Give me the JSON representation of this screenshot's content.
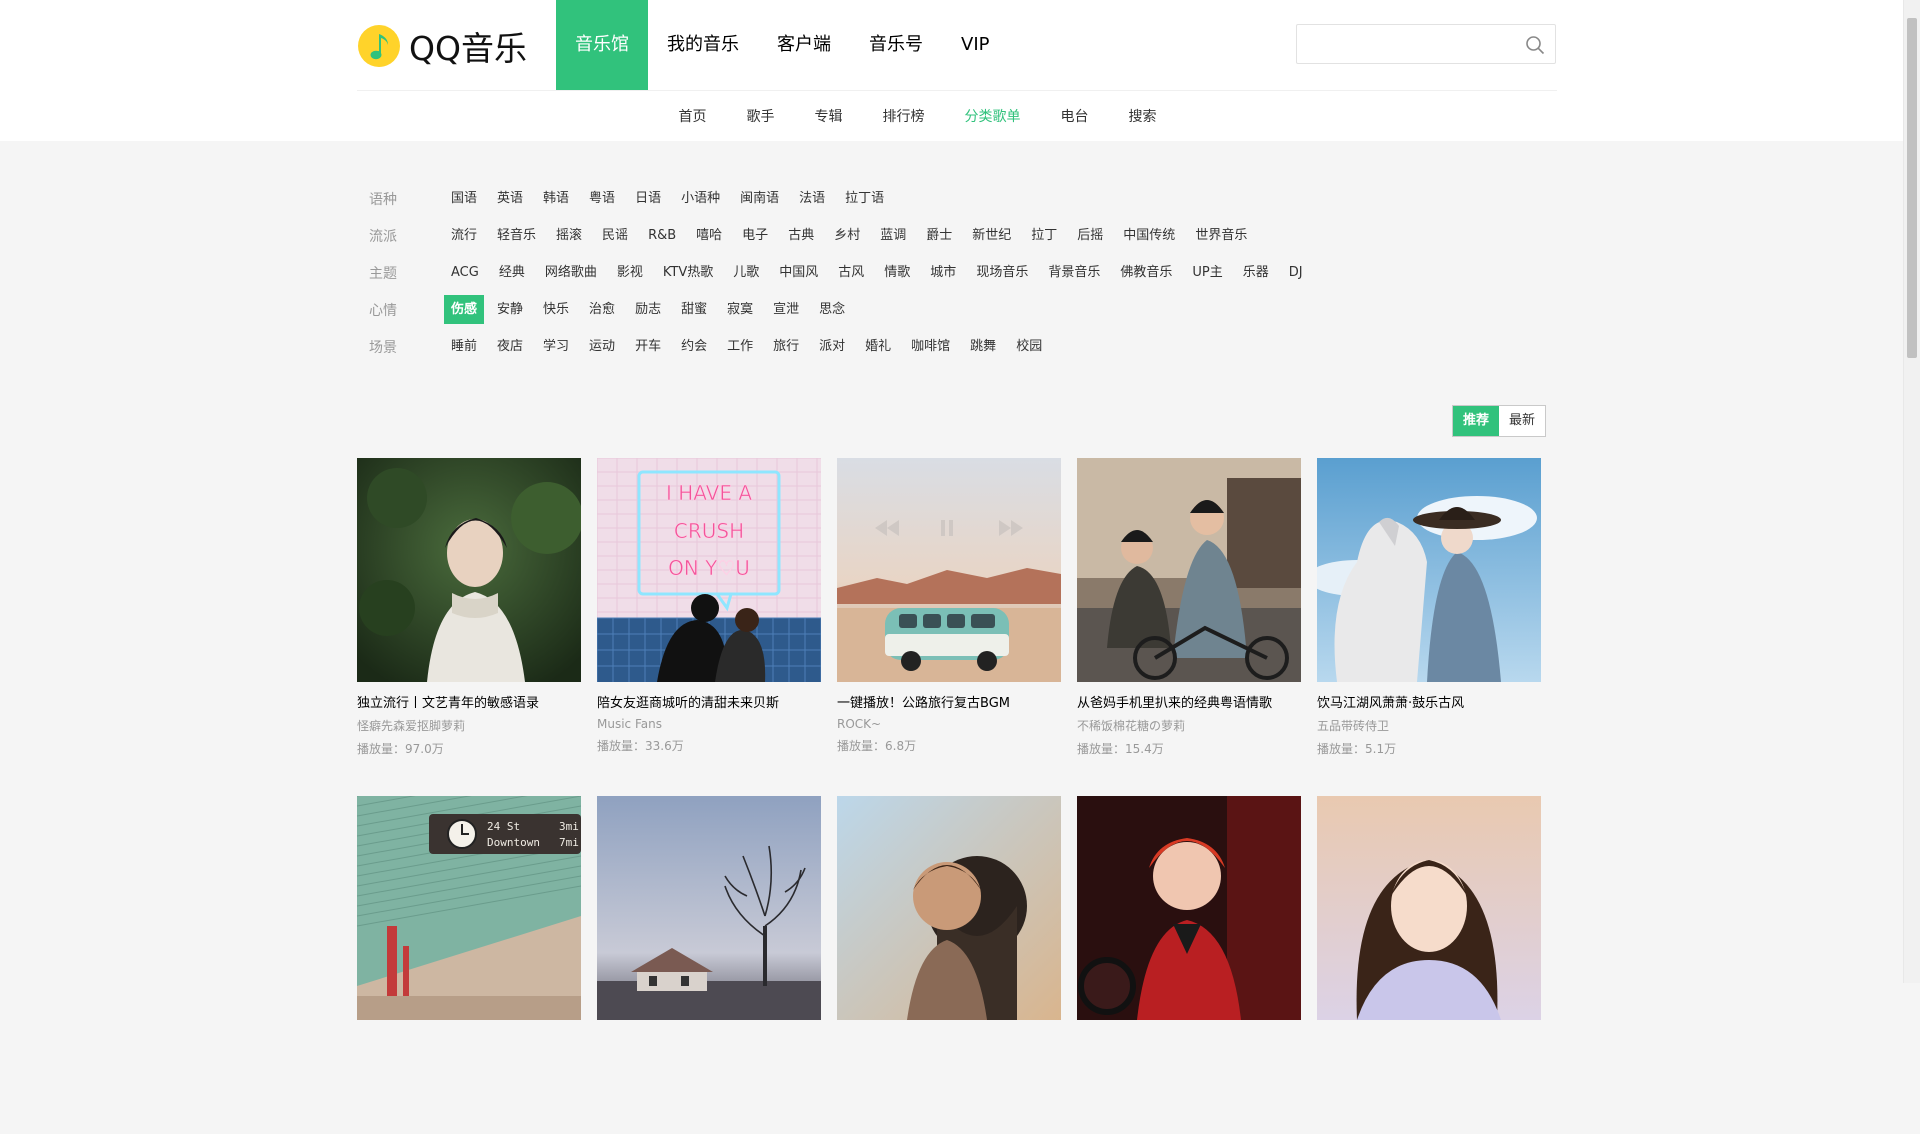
{
  "brand": {
    "name": "QQ音乐",
    "color": "#31c27c"
  },
  "main_nav": [
    {
      "label": "音乐馆",
      "active": true
    },
    {
      "label": "我的音乐",
      "active": false
    },
    {
      "label": "客户端",
      "active": false
    },
    {
      "label": "音乐号",
      "active": false
    },
    {
      "label": "VIP",
      "active": false
    }
  ],
  "search": {
    "placeholder": "",
    "value": ""
  },
  "sub_nav": [
    {
      "label": "首页",
      "active": false
    },
    {
      "label": "歌手",
      "active": false
    },
    {
      "label": "专辑",
      "active": false
    },
    {
      "label": "排行榜",
      "active": false
    },
    {
      "label": "分类歌单",
      "active": true
    },
    {
      "label": "电台",
      "active": false
    },
    {
      "label": "搜索",
      "active": false
    }
  ],
  "filters": [
    {
      "label": "语种",
      "tags": [
        "国语",
        "英语",
        "韩语",
        "粤语",
        "日语",
        "小语种",
        "闽南语",
        "法语",
        "拉丁语"
      ],
      "active": null
    },
    {
      "label": "流派",
      "tags": [
        "流行",
        "轻音乐",
        "摇滚",
        "民谣",
        "R&B",
        "嘻哈",
        "电子",
        "古典",
        "乡村",
        "蓝调",
        "爵士",
        "新世纪",
        "拉丁",
        "后摇",
        "中国传统",
        "世界音乐"
      ],
      "active": null
    },
    {
      "label": "主题",
      "tags": [
        "ACG",
        "经典",
        "网络歌曲",
        "影视",
        "KTV热歌",
        "儿歌",
        "中国风",
        "古风",
        "情歌",
        "城市",
        "现场音乐",
        "背景音乐",
        "佛教音乐",
        "UP主",
        "乐器",
        "DJ"
      ],
      "active": null
    },
    {
      "label": "心情",
      "tags": [
        "伤感",
        "安静",
        "快乐",
        "治愈",
        "励志",
        "甜蜜",
        "寂寞",
        "宣泄",
        "思念"
      ],
      "active": "伤感"
    },
    {
      "label": "场景",
      "tags": [
        "睡前",
        "夜店",
        "学习",
        "运动",
        "开车",
        "约会",
        "工作",
        "旅行",
        "派对",
        "婚礼",
        "咖啡馆",
        "跳舞",
        "校园"
      ],
      "active": null
    }
  ],
  "sort": {
    "options": [
      "推荐",
      "最新"
    ],
    "active": "推荐"
  },
  "playlists": [
    {
      "title": "独立流行丨文艺青年的敏感语录",
      "author": "怪癖先森爱抠脚萝莉",
      "plays": "播放量：97.0万",
      "cover": "forest-girl"
    },
    {
      "title": "陪女友逛商城听的清甜未来贝斯",
      "author": "Music Fans",
      "plays": "播放量：33.6万",
      "cover": "neon-crush",
      "cover_text": [
        "I HAVE A",
        "CRUSH",
        "ON Y♡U"
      ]
    },
    {
      "title": "一键播放！公路旅行复古BGM",
      "author": "ROCK~",
      "plays": "播放量：6.8万",
      "cover": "desert-van"
    },
    {
      "title": "从爸妈手机里扒来的经典粤语情歌",
      "author": "不稀饭棉花糖の萝莉",
      "plays": "播放量：15.4万",
      "cover": "bike-couple"
    },
    {
      "title": "饮马江湖风萧萧·鼓乐古风",
      "author": "五品带砖侍卫",
      "plays": "播放量：5.1万",
      "cover": "white-horse"
    },
    {
      "title": "",
      "author": "",
      "plays": "",
      "cover": "subway-station",
      "cover_text": [
        "24 St",
        "Downtown",
        "3mi",
        "7mi"
      ]
    },
    {
      "title": "",
      "author": "",
      "plays": "",
      "cover": "lonely-house"
    },
    {
      "title": "",
      "author": "",
      "plays": "",
      "cover": "sunlit-couple"
    },
    {
      "title": "",
      "author": "",
      "plays": "",
      "cover": "red-portrait"
    },
    {
      "title": "",
      "author": "",
      "plays": "",
      "cover": "soft-portrait"
    }
  ]
}
